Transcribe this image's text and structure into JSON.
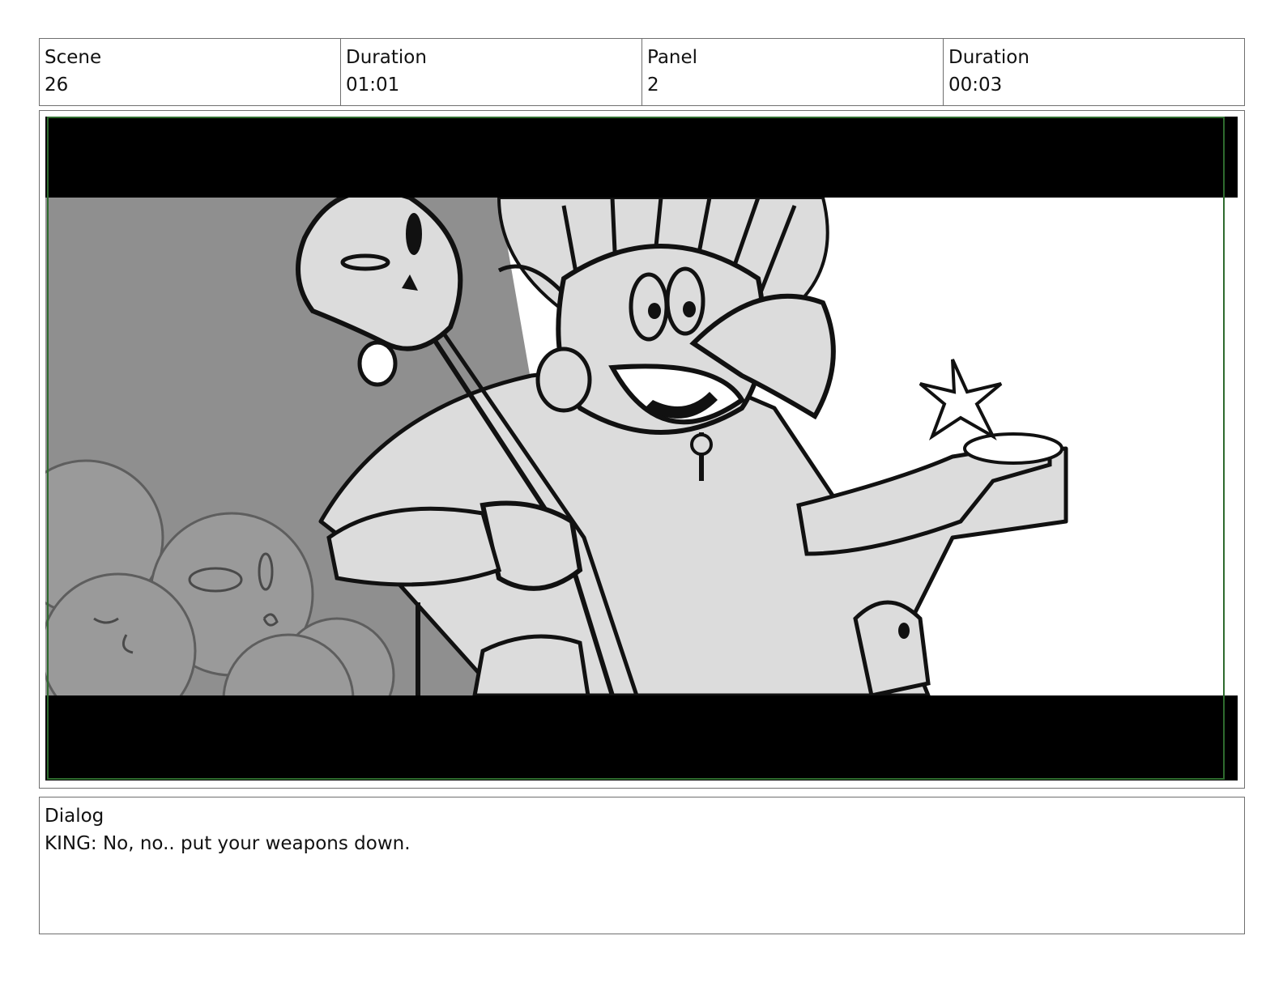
{
  "header": {
    "scene": {
      "label": "Scene",
      "value": "26"
    },
    "scene_duration": {
      "label": "Duration",
      "value": "01:01"
    },
    "panel": {
      "label": "Panel",
      "value": "2"
    },
    "panel_duration": {
      "label": "Duration",
      "value": "00:03"
    }
  },
  "panel_image": {
    "letterbox_color": "#000000",
    "frame_border_color": "#2e6b2e",
    "background_gray": "#8f8f8f",
    "fill_light": "#dcdcdc"
  },
  "dialog": {
    "label": "Dialog",
    "text": "KING: No, no.. put your weapons down."
  }
}
